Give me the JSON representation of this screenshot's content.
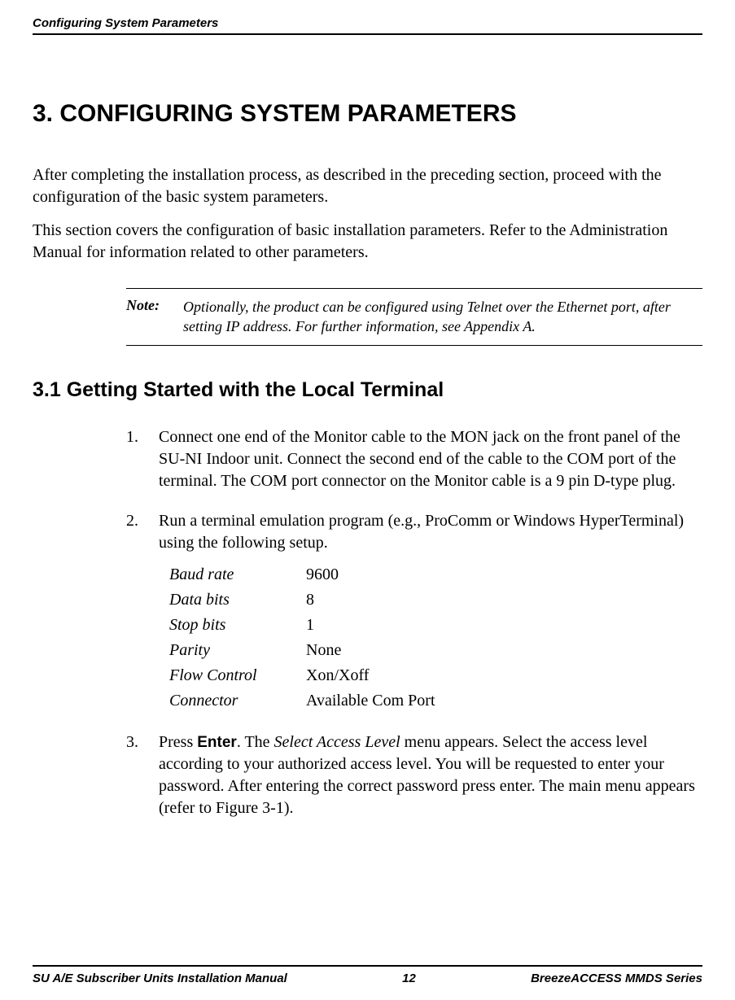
{
  "running_header": "Configuring System Parameters",
  "title": "3. CONFIGURING SYSTEM PARAMETERS",
  "intro_p1": "After completing the installation process, as described in the preceding section, proceed with the configuration of the basic system parameters.",
  "intro_p2": "This section covers the configuration of basic installation parameters. Refer to the Administration Manual for information related to other parameters.",
  "note_label": "Note:",
  "note_text": "Optionally, the product can be configured using Telnet over the Ethernet port, after setting IP address. For further information, see Appendix A.",
  "section_heading": "3.1  Getting Started with the Local Terminal",
  "step1": "Connect one end of the Monitor cable to the MON jack on the front panel of the SU-NI Indoor unit. Connect the second end of the cable to the COM port of the terminal. The COM port connector on the Monitor cable is a 9 pin D-type plug.",
  "step2": "Run a terminal emulation program (e.g., ProComm or Windows HyperTerminal) using the following setup.",
  "params": {
    "baud_rate_label": "Baud rate",
    "baud_rate_value": "9600",
    "data_bits_label": "Data bits",
    "data_bits_value": "8",
    "stop_bits_label": "Stop bits",
    "stop_bits_value": "1",
    "parity_label": "Parity",
    "parity_value": "None",
    "flow_control_label": "Flow Control",
    "flow_control_value": "Xon/Xoff",
    "connector_label": "Connector",
    "connector_value": "Available Com Port"
  },
  "step3_pre": "Press ",
  "step3_bold": "Enter",
  "step3_mid": ". The ",
  "step3_ital": "Select Access Level",
  "step3_post": " menu appears. Select the access level according to your authorized access level. You will be requested to enter your password. After entering the correct password press enter. The main menu appears (refer to Figure 3-1).",
  "footer_left": "SU A/E Subscriber Units Installation Manual",
  "footer_center": "12",
  "footer_right": "BreezeACCESS MMDS Series"
}
